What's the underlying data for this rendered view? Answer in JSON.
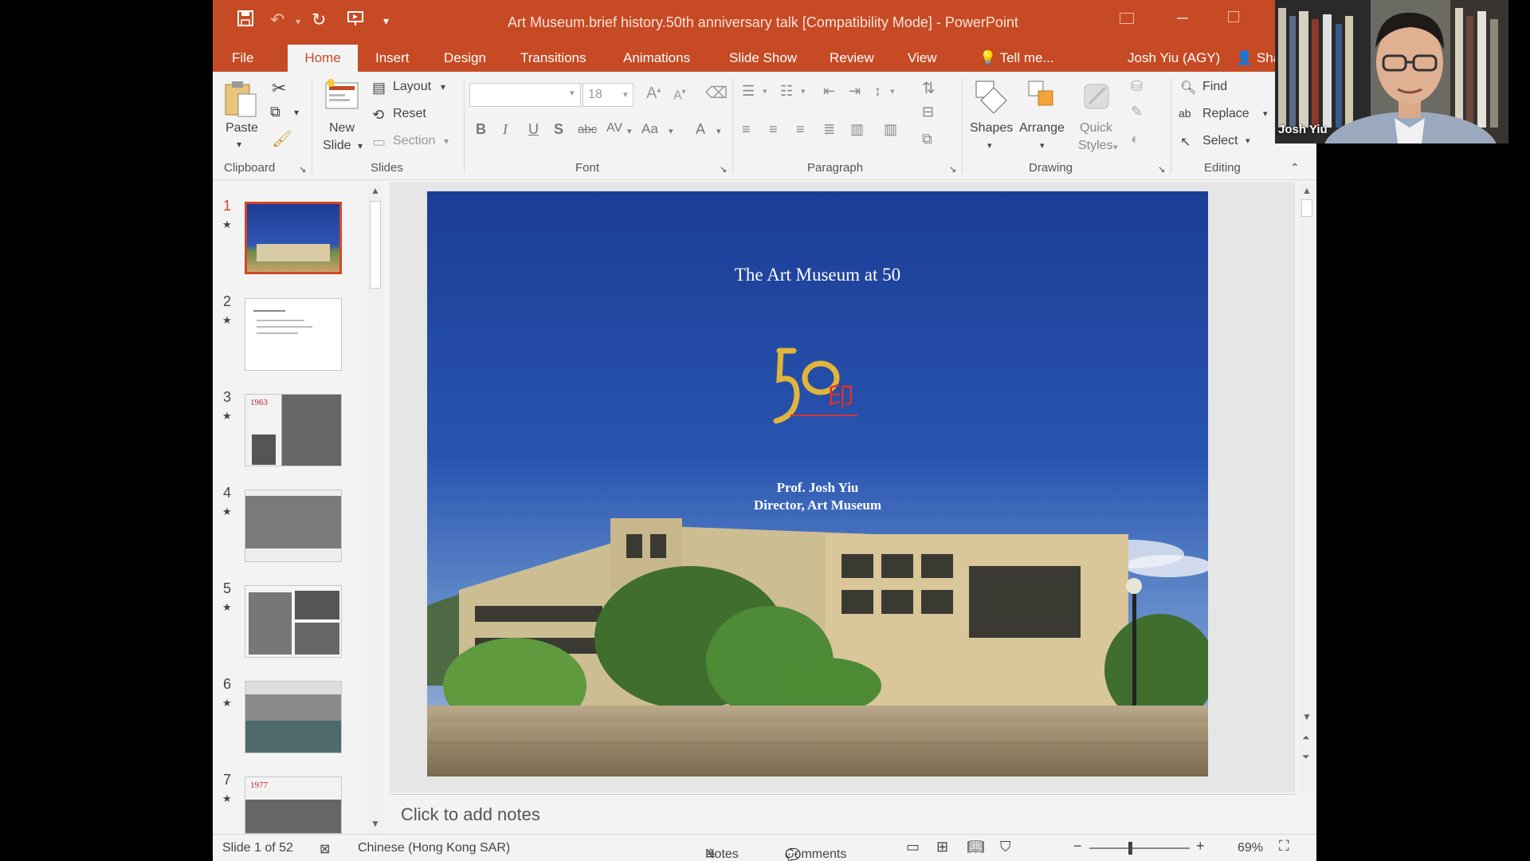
{
  "app": {
    "title": "Art Museum.brief history.50th anniversary talk [Compatibility Mode] - PowerPoint",
    "user": "Josh Yiu (AGY)",
    "share": "Sha",
    "tell_me": "Tell me..."
  },
  "tabs": [
    "File",
    "Home",
    "Insert",
    "Design",
    "Transitions",
    "Animations",
    "Slide Show",
    "Review",
    "View"
  ],
  "ribbon": {
    "clipboard": {
      "label": "Clipboard",
      "paste": "Paste"
    },
    "slides": {
      "label": "Slides",
      "new_slide_1": "New",
      "new_slide_2": "Slide",
      "layout": "Layout",
      "reset": "Reset",
      "section": "Section"
    },
    "font": {
      "label": "Font",
      "size": "18"
    },
    "paragraph": {
      "label": "Paragraph"
    },
    "drawing": {
      "label": "Drawing",
      "shapes": "Shapes",
      "arrange": "Arrange",
      "quick_1": "Quick",
      "quick_2": "Styles"
    },
    "editing": {
      "label": "Editing",
      "find": "Find",
      "replace": "Replace",
      "select": "Select"
    }
  },
  "thumbnails": [
    {
      "num": "1",
      "year": ""
    },
    {
      "num": "2",
      "year": ""
    },
    {
      "num": "3",
      "year": "1963"
    },
    {
      "num": "4",
      "year": ""
    },
    {
      "num": "5",
      "year": ""
    },
    {
      "num": "6",
      "year": ""
    },
    {
      "num": "7",
      "year": "1977"
    }
  ],
  "slide": {
    "title": "The Art Museum at 50",
    "presenter": "Prof. Josh Yiu",
    "role": "Director, Art Museum"
  },
  "notes": {
    "placeholder": "Click to add notes"
  },
  "status": {
    "slide_count": "Slide 1 of 52",
    "language": "Chinese (Hong Kong SAR)",
    "notes": "Notes",
    "comments": "Comments",
    "zoom": "69%"
  },
  "webcam": {
    "name": "Josh Yiu"
  }
}
